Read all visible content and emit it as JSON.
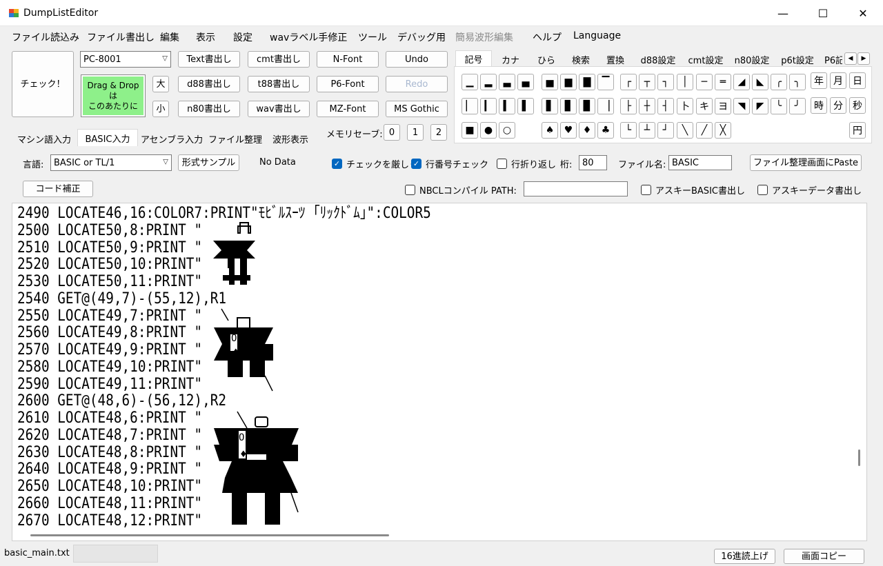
{
  "window": {
    "title": "DumpListEditor",
    "minimize": "—",
    "maximize": "☐",
    "close": "✕"
  },
  "menu": [
    "ファイル読込み",
    "ファイル書出し",
    "編集",
    "表示",
    "設定",
    "wavラベル手修正",
    "ツール",
    "デバッグ用",
    "簡易波形編集",
    "ヘルプ",
    "Language"
  ],
  "toolbar": {
    "check": "チェック！",
    "machine": "PC-8001",
    "drop_line1": "Drag & Drop",
    "drop_line2": "は",
    "drop_line3": "このあたりに",
    "big": "大",
    "small": "小",
    "text_out": "Text書出し",
    "cmt_out": "cmt書出し",
    "nfont": "N-Font",
    "undo": "Undo",
    "d88_out": "d88書出し",
    "t88_out": "t88書出し",
    "p6font": "P6-Font",
    "redo": "Redo",
    "n80_out": "n80書出し",
    "wav_out": "wav書出し",
    "mzfont": "MZ-Font",
    "msgothic": "MS Gothic",
    "memory_label": "メモリセーブ:",
    "mem0": "0",
    "mem1": "1",
    "mem2": "2"
  },
  "mode_tabs": [
    "マシン語入力",
    "BASIC入力",
    "アセンブラ入力",
    "ファイル整理",
    "波形表示"
  ],
  "symbol_tabs": [
    "記号",
    "カナ",
    "ひら",
    "検索",
    "置換",
    "d88設定",
    "cmt設定",
    "n80設定",
    "p6t設定",
    "P6記"
  ],
  "symbols": {
    "row1": [
      "▁",
      "▂",
      "▃",
      "▄",
      "▅",
      "▆",
      "▇",
      "▔",
      "┌",
      "┬",
      "┐",
      "│",
      "─",
      "═",
      "◢",
      "◣",
      "╭",
      "╮"
    ],
    "row2": [
      "▏",
      "▎",
      "▍",
      "▌",
      "▋",
      "▊",
      "▉",
      "▕",
      "├",
      "┼",
      "┤",
      "卜",
      "キ",
      "ヨ",
      "◥",
      "◤",
      "╰",
      "╯"
    ],
    "row3": [
      "■",
      "●",
      "○",
      "♠",
      "♥",
      "♦",
      "♣",
      "└",
      "┴",
      "┘",
      "╲",
      "╱",
      "╳"
    ],
    "time": [
      "年",
      "月",
      "日",
      "時",
      "分",
      "秒"
    ],
    "yen": "円"
  },
  "options": {
    "lang_label": "言語:",
    "lang_value": "BASIC or TL/1",
    "format_sample": "形式サンプル",
    "no_data": "No Data",
    "strict_check": "チェックを厳しく",
    "lineno_check": "行番号チェック",
    "wrap": "行折り返し",
    "digits_label": "桁:",
    "digits_value": "80",
    "filename_label": "ファイル名:",
    "filename_value": "BASIC",
    "paste_btn": "ファイル整理画面にPaste",
    "code_fix": "コード補正",
    "nbcl_label": "NBCLコンパイル PATH:",
    "ascii_basic": "アスキーBASIC書出し",
    "ascii_data": "アスキーデータ書出し"
  },
  "code_lines": [
    "2490 LOCATE46,16:COLOR7:PRINT\"ﾓﾋﾞﾙｽｰﾂ ｢ﾘｯｸﾄﾞﾑ｣\":COLOR5",
    "2500 LOCATE50,8:PRINT \"",
    "2510 LOCATE50,9:PRINT \"",
    "2520 LOCATE50,10:PRINT\"",
    "2530 LOCATE50,11:PRINT\"",
    "2540 GET@(49,7)-(55,12),R1",
    "2550 LOCATE49,7:PRINT \"",
    "2560 LOCATE49,8:PRINT \"",
    "2570 LOCATE49,9:PRINT \"",
    "2580 LOCATE49,10:PRINT\"",
    "2590 LOCATE49,11:PRINT\"",
    "2600 GET@(48,6)-(56,12),R2",
    "2610 LOCATE48,6:PRINT \"",
    "2620 LOCATE48,7:PRINT \"",
    "2630 LOCATE48,8:PRINT \"",
    "2640 LOCATE48,9:PRINT \"",
    "2650 LOCATE48,10:PRINT\"",
    "2660 LOCATE48,11:PRINT\"",
    "2670 LOCATE48,12:PRINT\""
  ],
  "status": {
    "filename": "basic_main.txt",
    "hex_read": "16進読上げ",
    "screen_copy": "画面コピー"
  }
}
